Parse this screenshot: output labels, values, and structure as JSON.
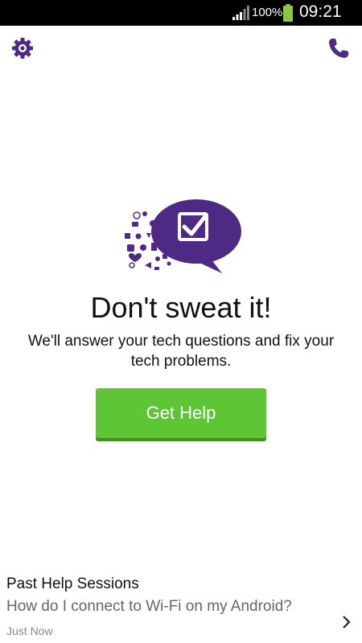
{
  "status_bar": {
    "battery_percent": "100%",
    "time": "09:21",
    "icons": [
      "signal-icon",
      "battery-icon"
    ]
  },
  "toolbar": {
    "settings_icon": "gear-icon",
    "call_icon": "phone-icon"
  },
  "hero": {
    "title": "Don't sweat it!",
    "subtitle": "We'll answer your tech questions and fix your tech problems.",
    "button_label": "Get Help",
    "illustration": "chat-bubble-checkmark-icon"
  },
  "past_sessions": {
    "heading": "Past Help Sessions",
    "items": [
      {
        "question": "How do I connect to Wi-Fi on my Android?",
        "time": "Just Now"
      }
    ]
  },
  "colors": {
    "accent": "#4e2a84",
    "button": "#5ec535",
    "button_shadow": "#3f8f22",
    "battery": "#8dc63f"
  }
}
